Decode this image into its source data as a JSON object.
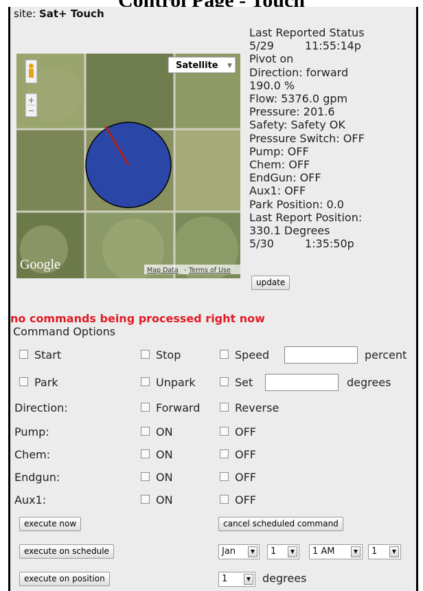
{
  "page_title": "Control Page - Touch",
  "site": {
    "label": "site:",
    "name": "Sat+ Touch"
  },
  "map": {
    "type_button": "Satellite",
    "brand": "Google",
    "map_data_link": "Map Data",
    "separator": "-",
    "terms_link": "Terms of Use"
  },
  "status": {
    "heading": "Last Reported Status",
    "date1": "5/29",
    "time1": "11:55:14p",
    "pivot": "Pivot on",
    "direction": "Direction: forward",
    "percent": "190.0 %",
    "flow": "Flow: 5376.0 gpm",
    "pressure": "Pressure: 201.6",
    "safety": "Safety: Safety OK",
    "pressure_switch": "Pressure Switch: OFF",
    "pump": "Pump: OFF",
    "chem": "Chem: OFF",
    "endgun": "EndGun: OFF",
    "aux1": "Aux1: OFF",
    "park_position": "Park Position: 0.0",
    "last_report_position": "Last Report Position:",
    "degrees": "330.1 Degrees",
    "date2": "5/30",
    "time2": "1:35:50p",
    "update_button": "update"
  },
  "alert": "no commands being processed right now",
  "commands": {
    "title": "Command Options",
    "start": "Start",
    "stop": "Stop",
    "speed": "Speed",
    "percent_unit": "percent",
    "park": "Park",
    "unpark": "Unpark",
    "set": "Set",
    "degrees_unit": "degrees",
    "direction_label": "Direction:",
    "forward": "Forward",
    "reverse": "Reverse",
    "pump_label": "Pump:",
    "chem_label": "Chem:",
    "endgun_label": "Endgun:",
    "aux1_label": "Aux1:",
    "on": "ON",
    "off": "OFF"
  },
  "actions": {
    "execute_now": "execute now",
    "cancel_scheduled": "cancel scheduled command",
    "execute_on_schedule": "execute on schedule",
    "execute_on_position": "execute on position"
  },
  "schedule": {
    "month": "Jan",
    "day": "1",
    "hour": "1 AM",
    "minute": "1"
  },
  "position": {
    "value": "1",
    "unit": "degrees"
  }
}
